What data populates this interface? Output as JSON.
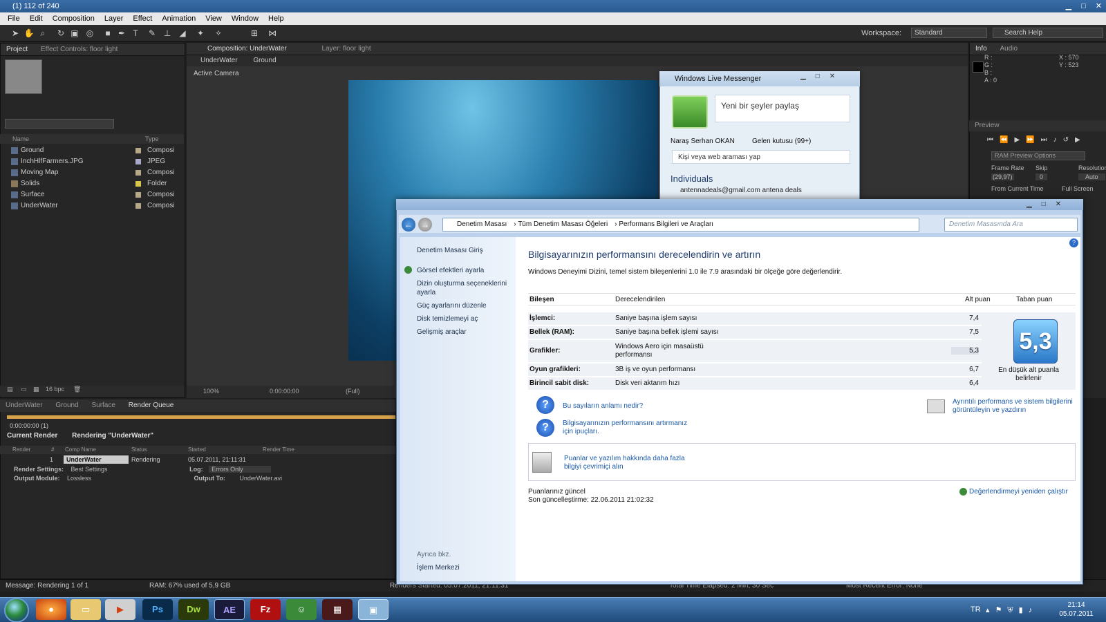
{
  "ae": {
    "title": "(1) 112 of 240",
    "menu": [
      "File",
      "Edit",
      "Composition",
      "Layer",
      "Effect",
      "Animation",
      "View",
      "Window",
      "Help"
    ],
    "workspace_label": "Workspace:",
    "workspace_value": "Standard",
    "search_help": "Search Help",
    "project_tabs": [
      "Project",
      "Effect Controls: floor light"
    ],
    "project_columns": [
      "Name",
      "Type"
    ],
    "project_items": [
      {
        "name": "Ground",
        "type": "Composi"
      },
      {
        "name": "InchHlfFarmers.JPG",
        "type": "JPEG"
      },
      {
        "name": "Moving Map",
        "type": "Composi"
      },
      {
        "name": "Solids",
        "type": "Folder"
      },
      {
        "name": "Surface",
        "type": "Composi"
      },
      {
        "name": "UnderWater",
        "type": "Composi"
      }
    ],
    "bpc": "16 bpc",
    "comp_tabs": [
      "Composition: UnderWater",
      "Layer: floor light"
    ],
    "comp_breadcrumb": [
      "UnderWater",
      "Ground"
    ],
    "active_camera": "Active Camera",
    "zoom": "100%",
    "timecode": "0:00:00:00",
    "resolution": "(Full)",
    "info_tabs": [
      "Info",
      "Audio"
    ],
    "info_values": "R :\nG :\nB :\nA : 0",
    "info_x": "X : 570",
    "info_y": "Y : 523",
    "preview_tab": "Preview",
    "ram_preview": "RAM Preview Options",
    "frame_rate_label": "Frame Rate",
    "skip_label": "Skip",
    "resolution_label": "Resolution",
    "frame_rate": "(29,97)",
    "skip": "0",
    "res_value": "Auto",
    "from_current": "From Current Time",
    "full_screen": "Full Screen",
    "timeline_tabs": [
      "UnderWater",
      "Ground",
      "Surface",
      "Render Queue"
    ],
    "rq_time": "0:00:00:00 (1)",
    "current_render": "Current Render",
    "rendering": "Rendering \"UnderWater\"",
    "rq_columns": [
      "Render",
      "#",
      "Comp Name",
      "Status",
      "Started",
      "Render Time"
    ],
    "rq_row": {
      "num": "1",
      "comp": "UnderWater",
      "status": "Rendering",
      "started": "05.07.2011, 21:11:31"
    },
    "render_settings_label": "Render Settings:",
    "render_settings": "Best Settings",
    "log_label": "Log:",
    "log_value": "Errors Only",
    "output_module_label": "Output Module:",
    "output_module": "Lossless",
    "output_to_label": "Output To:",
    "output_to": "UnderWater.avi",
    "status": {
      "message": "Message:  Rendering 1 of 1",
      "ram": "RAM:  67% used of 5,9 GB",
      "renders_started": "Renders Started:  05.07.2011, 21:11:31",
      "elapsed": "Total Time Elapsed:  2 Min, 30 Sec",
      "recent_error": "Most Recent Error:  None"
    }
  },
  "messenger": {
    "title": "Windows Live Messenger",
    "status_prompt": "Yeni bir şeyler paylaş",
    "user_name": "Naraş Serhan OKAN",
    "inbox": "Gelen kutusu (99+)",
    "search_placeholder": "Kişi veya web araması yap",
    "group": "Individuals",
    "contact": "antennadeals@gmail.com antena deals"
  },
  "control_panel": {
    "breadcrumb": [
      "Denetim Masası",
      "Tüm Denetim Masası Öğeleri",
      "Performans Bilgileri ve Araçları"
    ],
    "search_placeholder": "Denetim Masasında Ara",
    "sidebar_home": "Denetim Masası Giriş",
    "sidebar_links": [
      "Görsel efektleri ayarla",
      "Dizin oluşturma seçeneklerini ayarla",
      "Güç ayarlarını düzenle",
      "Disk temizlemeyi aç",
      "Gelişmiş araçlar"
    ],
    "see_also": "Ayrıca bkz.",
    "action_center": "İşlem Merkezi",
    "heading": "Bilgisayarınızın performansını derecelendirin ve artırın",
    "subtitle": "Windows Deneyimi Dizini, temel sistem bileşenlerini 1.0 ile 7.9 arasındaki bir ölçeğe göre değerlendirir.",
    "columns": [
      "Bileşen",
      "Derecelendirilen",
      "Alt puan",
      "Taban puan"
    ],
    "rows": [
      {
        "component": "İşlemci:",
        "rated": "Saniye başına işlem sayısı",
        "score": "7,4"
      },
      {
        "component": "Bellek (RAM):",
        "rated": "Saniye başına bellek işlemi sayısı",
        "score": "7,5"
      },
      {
        "component": "Grafikler:",
        "rated": "Windows Aero için masaüstü performansı",
        "score": "5,3"
      },
      {
        "component": "Oyun grafikleri:",
        "rated": "3B iş ve oyun performansı",
        "score": "6,7"
      },
      {
        "component": "Birincil sabit disk:",
        "rated": "Disk veri aktarım hızı",
        "score": "6,4"
      }
    ],
    "base_score": "5,3",
    "base_caption": "En düşük alt puanla belirlenir",
    "link_meaning": "Bu sayıların anlamı nedir?",
    "link_tips": "Bilgisayarınızın performansını artırmanız için ipuçları.",
    "link_details": "Ayrıntılı performans ve sistem bilgilerini görüntüleyin ve yazdırın",
    "link_online": "Puanlar ve yazılım hakkında daha fazla bilgiyi çevrimiçi alın",
    "scores_current": "Puanlarınız güncel",
    "last_update": "Son güncelleştirme: 22.06.2011 21:02:32",
    "rerun": "Değerlendirmeyi yeniden çalıştır"
  },
  "taskbar": {
    "apps": [
      "Ps",
      "Dw",
      "AE",
      "Fz"
    ],
    "lang": "TR",
    "time": "21:14",
    "date": "05.07.2011"
  }
}
